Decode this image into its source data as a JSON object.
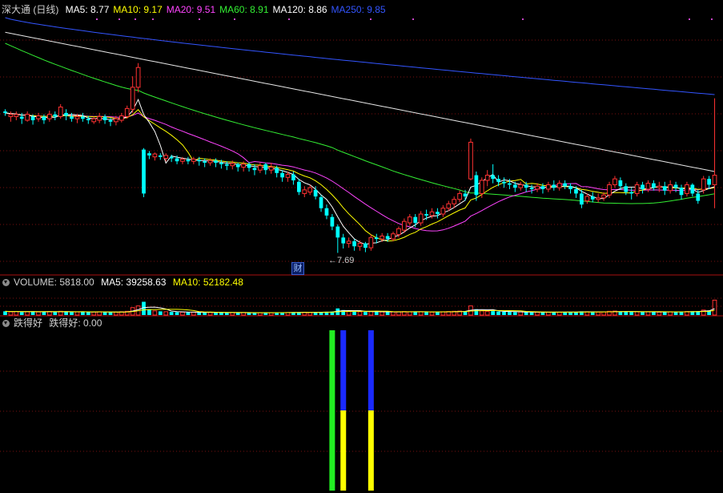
{
  "header": {
    "stock_name": "深大通 (日线)",
    "ma_items": [
      {
        "label": "MA5: 8.77",
        "color": "#ffffff"
      },
      {
        "label": "MA10: 9.17",
        "color": "#ffff00"
      },
      {
        "label": "MA20: 9.51",
        "color": "#ff44ff"
      },
      {
        "label": "MA60: 8.91",
        "color": "#33ee33"
      },
      {
        "label": "MA120: 8.86",
        "color": "#ffffff"
      },
      {
        "label": "MA250: 9.85",
        "color": "#3355ff"
      }
    ]
  },
  "volume_header": {
    "title": "VOLUME: 5818.00",
    "ma5": "MA5: 39258.63",
    "ma10": "MA10: 52182.48"
  },
  "indicator_header": {
    "title": "跌得好",
    "value": "跌得好: 0.00"
  },
  "annotations": {
    "low_price": "7.69",
    "event_tag": "财"
  },
  "colors": {
    "up": "#ff3232",
    "down": "#00ffff",
    "grid": "#7a1010",
    "ma5": "#ffffff",
    "ma10": "#ffff00",
    "ma20": "#ff44ff",
    "ma60": "#33ee33",
    "ma120": "#e6e6e6",
    "ma250": "#3355ff"
  },
  "chart_data": [
    {
      "type": "candlestick",
      "title": "深大通 (日线)",
      "ylim": [
        7.4,
        10.9
      ],
      "candles": [
        [
          9.62,
          9.6,
          9.65,
          9.56
        ],
        [
          9.55,
          9.58,
          9.62,
          9.48
        ],
        [
          9.55,
          9.58,
          9.62,
          9.5
        ],
        [
          9.55,
          9.52,
          9.6,
          9.45
        ],
        [
          9.5,
          9.58,
          9.62,
          9.48
        ],
        [
          9.55,
          9.5,
          9.58,
          9.44
        ],
        [
          9.52,
          9.56,
          9.6,
          9.48
        ],
        [
          9.55,
          9.5,
          9.58,
          9.45
        ],
        [
          9.52,
          9.58,
          9.63,
          9.48
        ],
        [
          9.58,
          9.55,
          9.62,
          9.5
        ],
        [
          9.55,
          9.68,
          9.72,
          9.52
        ],
        [
          9.6,
          9.56,
          9.65,
          9.5
        ],
        [
          9.55,
          9.52,
          9.6,
          9.48
        ],
        [
          9.52,
          9.55,
          9.58,
          9.46
        ],
        [
          9.55,
          9.52,
          9.6,
          9.48
        ],
        [
          9.52,
          9.5,
          9.56,
          9.45
        ],
        [
          9.48,
          9.52,
          9.55,
          9.45
        ],
        [
          9.5,
          9.55,
          9.6,
          9.46
        ],
        [
          9.55,
          9.5,
          9.58,
          9.45
        ],
        [
          9.5,
          9.48,
          9.53,
          9.42
        ],
        [
          9.48,
          9.52,
          9.56,
          9.43
        ],
        [
          9.5,
          9.56,
          9.6,
          9.47
        ],
        [
          9.55,
          9.66,
          9.7,
          9.52
        ],
        [
          9.65,
          9.95,
          10.1,
          9.6
        ],
        [
          9.95,
          10.22,
          10.28,
          9.88
        ],
        [
          9.1,
          8.5,
          9.12,
          8.45
        ],
        [
          9.05,
          9.02,
          9.08,
          8.97
        ],
        [
          9.0,
          9.04,
          9.06,
          8.95
        ],
        [
          9.02,
          9.0,
          9.05,
          8.96
        ],
        [
          8.98,
          9.02,
          9.05,
          8.94
        ],
        [
          9.0,
          8.98,
          9.03,
          8.93
        ],
        [
          8.98,
          8.94,
          9.02,
          8.9
        ],
        [
          8.94,
          8.97,
          9.0,
          8.9
        ],
        [
          8.96,
          8.94,
          9.0,
          8.9
        ],
        [
          8.94,
          8.97,
          9.0,
          8.9
        ],
        [
          8.96,
          8.94,
          9.0,
          8.88
        ],
        [
          8.94,
          8.92,
          8.98,
          8.86
        ],
        [
          8.92,
          8.95,
          8.98,
          8.88
        ],
        [
          8.95,
          8.92,
          8.98,
          8.86
        ],
        [
          8.92,
          8.9,
          8.96,
          8.84
        ],
        [
          8.9,
          8.88,
          8.94,
          8.82
        ],
        [
          8.88,
          8.91,
          8.95,
          8.83
        ],
        [
          8.9,
          8.86,
          8.92,
          8.8
        ],
        [
          8.86,
          8.9,
          8.94,
          8.8
        ],
        [
          8.9,
          8.85,
          8.93,
          8.8
        ],
        [
          8.85,
          8.82,
          8.9,
          8.75
        ],
        [
          8.82,
          8.88,
          8.92,
          8.78
        ],
        [
          8.9,
          8.82,
          8.92,
          8.76
        ],
        [
          8.82,
          8.86,
          8.92,
          8.77
        ],
        [
          8.85,
          8.78,
          8.88,
          8.72
        ],
        [
          8.78,
          8.72,
          8.82,
          8.66
        ],
        [
          8.72,
          8.76,
          8.8,
          8.66
        ],
        [
          8.76,
          8.68,
          8.8,
          8.62
        ],
        [
          8.66,
          8.52,
          8.7,
          8.48
        ],
        [
          8.5,
          8.55,
          8.6,
          8.45
        ],
        [
          8.52,
          8.58,
          8.62,
          8.48
        ],
        [
          8.55,
          8.46,
          8.6,
          8.42
        ],
        [
          8.45,
          8.3,
          8.48,
          8.25
        ],
        [
          8.3,
          8.2,
          8.35,
          8.15
        ],
        [
          8.18,
          8.05,
          8.22,
          8.0
        ],
        [
          8.05,
          7.9,
          8.08,
          7.69
        ],
        [
          7.9,
          7.82,
          7.95,
          7.75
        ],
        [
          7.82,
          7.85,
          7.9,
          7.76
        ],
        [
          7.85,
          7.78,
          7.88,
          7.72
        ],
        [
          7.78,
          7.82,
          7.86,
          7.72
        ],
        [
          7.82,
          7.76,
          7.84,
          7.7
        ],
        [
          7.76,
          7.9,
          7.94,
          7.72
        ],
        [
          7.9,
          7.88,
          7.95,
          7.82
        ],
        [
          7.88,
          7.92,
          7.96,
          7.84
        ],
        [
          7.92,
          7.88,
          7.96,
          7.84
        ],
        [
          7.88,
          7.95,
          7.98,
          7.85
        ],
        [
          7.94,
          8.02,
          8.05,
          7.9
        ],
        [
          8.0,
          8.12,
          8.16,
          7.96
        ],
        [
          8.1,
          8.18,
          8.22,
          8.06
        ],
        [
          8.18,
          8.1,
          8.22,
          8.04
        ],
        [
          8.1,
          8.22,
          8.26,
          8.06
        ],
        [
          8.22,
          8.2,
          8.28,
          8.14
        ],
        [
          8.2,
          8.25,
          8.3,
          8.16
        ],
        [
          8.25,
          8.22,
          8.3,
          8.16
        ],
        [
          8.22,
          8.3,
          8.34,
          8.18
        ],
        [
          8.3,
          8.36,
          8.4,
          8.26
        ],
        [
          8.36,
          8.42,
          8.46,
          8.3
        ],
        [
          8.42,
          8.5,
          8.54,
          8.38
        ],
        [
          8.5,
          8.46,
          8.55,
          8.4
        ],
        [
          8.7,
          9.2,
          9.25,
          8.68
        ],
        [
          8.75,
          8.48,
          8.8,
          8.4
        ],
        [
          8.5,
          8.68,
          8.72,
          8.44
        ],
        [
          8.68,
          8.75,
          8.82,
          8.6
        ],
        [
          8.75,
          8.7,
          8.9,
          8.64
        ],
        [
          8.7,
          8.66,
          8.75,
          8.6
        ],
        [
          8.66,
          8.64,
          8.72,
          8.58
        ],
        [
          8.64,
          8.62,
          8.7,
          8.56
        ],
        [
          8.62,
          8.58,
          8.66,
          8.52
        ],
        [
          8.58,
          8.62,
          8.66,
          8.54
        ],
        [
          8.62,
          8.58,
          8.66,
          8.52
        ],
        [
          8.58,
          8.56,
          8.62,
          8.5
        ],
        [
          8.56,
          8.6,
          8.64,
          8.52
        ],
        [
          8.6,
          8.56,
          8.64,
          8.5
        ],
        [
          8.56,
          8.62,
          8.66,
          8.52
        ],
        [
          8.62,
          8.58,
          8.68,
          8.54
        ],
        [
          8.58,
          8.64,
          8.68,
          8.54
        ],
        [
          8.64,
          8.6,
          8.68,
          8.56
        ],
        [
          8.6,
          8.56,
          8.64,
          8.5
        ],
        [
          8.56,
          8.5,
          8.6,
          8.44
        ],
        [
          8.5,
          8.35,
          8.55,
          8.3
        ],
        [
          8.4,
          8.46,
          8.5,
          8.36
        ],
        [
          8.46,
          8.42,
          8.52,
          8.38
        ],
        [
          8.42,
          8.44,
          8.5,
          8.38
        ],
        [
          8.44,
          8.48,
          8.52,
          8.4
        ],
        [
          8.48,
          8.62,
          8.66,
          8.44
        ],
        [
          8.62,
          8.7,
          8.74,
          8.58
        ],
        [
          8.68,
          8.6,
          8.72,
          8.55
        ],
        [
          8.6,
          8.52,
          8.64,
          8.48
        ],
        [
          8.52,
          8.5,
          8.58,
          8.42
        ],
        [
          8.5,
          8.62,
          8.66,
          8.46
        ],
        [
          8.62,
          8.56,
          8.66,
          8.5
        ],
        [
          8.56,
          8.64,
          8.68,
          8.52
        ],
        [
          8.64,
          8.58,
          8.68,
          8.54
        ],
        [
          8.58,
          8.6,
          8.66,
          8.52
        ],
        [
          8.6,
          8.54,
          8.66,
          8.48
        ],
        [
          8.54,
          8.62,
          8.68,
          8.5
        ],
        [
          8.62,
          8.58,
          8.66,
          8.52
        ],
        [
          8.58,
          8.48,
          8.62,
          8.42
        ],
        [
          8.5,
          8.62,
          8.66,
          8.46
        ],
        [
          8.62,
          8.5,
          8.64,
          8.46
        ],
        [
          8.5,
          8.4,
          8.55,
          8.36
        ],
        [
          8.55,
          8.7,
          8.74,
          8.5
        ],
        [
          8.7,
          8.62,
          8.74,
          8.56
        ],
        [
          8.62,
          8.75,
          9.8,
          8.3
        ]
      ]
    },
    {
      "type": "bar",
      "title": "VOLUME",
      "ylim": [
        0,
        60000
      ],
      "values": [
        9000,
        8000,
        8500,
        7000,
        8000,
        9000,
        7500,
        8000,
        8500,
        7000,
        9000,
        8000,
        7000,
        7500,
        8000,
        7000,
        7500,
        8000,
        7000,
        6500,
        7000,
        8000,
        9000,
        18000,
        22000,
        32000,
        14000,
        10000,
        9000,
        8000,
        7500,
        7000,
        7000,
        6500,
        7000,
        6500,
        6000,
        6500,
        6000,
        6000,
        5500,
        6000,
        5500,
        6000,
        5500,
        6000,
        5500,
        6000,
        5500,
        6000,
        6500,
        6000,
        6500,
        7000,
        6500,
        6000,
        7000,
        7500,
        8000,
        8500,
        16000,
        12000,
        9000,
        8000,
        8000,
        7500,
        9000,
        8000,
        7500,
        7000,
        7500,
        8000,
        8500,
        8000,
        7500,
        8000,
        7500,
        7000,
        7500,
        8000,
        8500,
        9000,
        9500,
        9000,
        22000,
        14000,
        10000,
        9000,
        9500,
        8500,
        8000,
        7500,
        7000,
        7500,
        7000,
        6500,
        7000,
        6500,
        7000,
        7500,
        7000,
        7500,
        7000,
        7500,
        9000,
        8000,
        7500,
        7000,
        7500,
        9000,
        9500,
        8500,
        8000,
        7500,
        8000,
        7500,
        8000,
        7500,
        7000,
        7500,
        8000,
        7500,
        8000,
        8500,
        9000,
        9500,
        12000,
        11000,
        36000
      ],
      "ma5": "MA5: 39258.63",
      "ma10": "MA10: 52182.48"
    },
    {
      "type": "bar",
      "title": "跌得好",
      "ylim": [
        0,
        1
      ],
      "bars": [
        {
          "index": 59,
          "segments": [
            {
              "from": 0,
              "to": 1,
              "color": "#22ee22"
            }
          ]
        },
        {
          "index": 61,
          "segments": [
            {
              "from": 0,
              "to": 0.5,
              "color": "#ffff00"
            },
            {
              "from": 0.5,
              "to": 1,
              "color": "#1a2aff"
            }
          ]
        },
        {
          "index": 66,
          "segments": [
            {
              "from": 0,
              "to": 0.5,
              "color": "#ffff00"
            },
            {
              "from": 0.5,
              "to": 1,
              "color": "#1a2aff"
            }
          ]
        }
      ]
    }
  ]
}
